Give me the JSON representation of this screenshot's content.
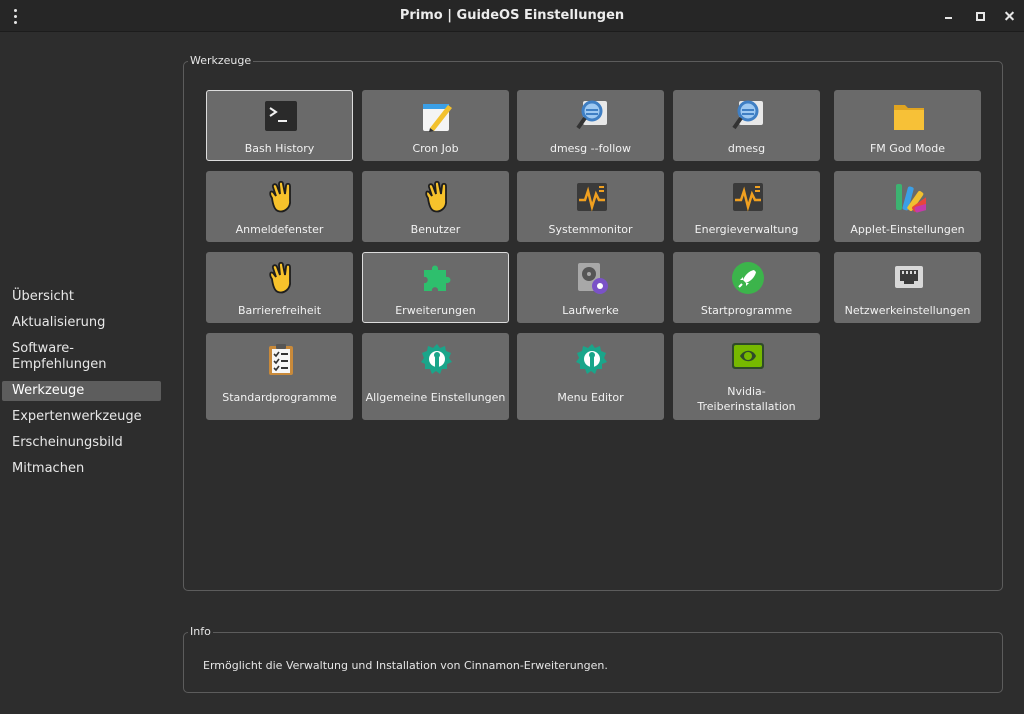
{
  "window": {
    "title": "Primo | GuideOS Einstellungen"
  },
  "sidebar": {
    "items": [
      {
        "label": "Übersicht"
      },
      {
        "label": "Aktualisierung"
      },
      {
        "label": "Software-\nEmpfehlungen"
      },
      {
        "label": "Werkzeuge"
      },
      {
        "label": "Expertenwerkzeuge"
      },
      {
        "label": "Erscheinungsbild"
      },
      {
        "label": "Mitmachen"
      }
    ],
    "selected": "Werkzeuge"
  },
  "tools": {
    "section_label": "Werkzeuge",
    "tiles": [
      {
        "label": "Bash History",
        "icon": "terminal-icon"
      },
      {
        "label": "Cron Job",
        "icon": "notepad-pencil-icon"
      },
      {
        "label": "dmesg --follow",
        "icon": "log-search-icon"
      },
      {
        "label": "dmesg",
        "icon": "log-search-icon"
      },
      {
        "label": "FM God Mode",
        "icon": "folder-icon"
      },
      {
        "label": "Anmeldefenster",
        "icon": "waving-hand-icon"
      },
      {
        "label": "Benutzer",
        "icon": "waving-hand-icon"
      },
      {
        "label": "Systemmonitor",
        "icon": "activity-monitor-icon"
      },
      {
        "label": "Energieverwaltung",
        "icon": "activity-monitor-icon"
      },
      {
        "label": "Applet-Einstellungen",
        "icon": "color-palette-icon"
      },
      {
        "label": "Barrierefreiheit",
        "icon": "waving-hand-icon"
      },
      {
        "label": "Erweiterungen",
        "icon": "puzzle-piece-icon"
      },
      {
        "label": "Laufwerke",
        "icon": "disk-settings-icon"
      },
      {
        "label": "Startprogramme",
        "icon": "rocket-icon"
      },
      {
        "label": "Netzwerkeinstellungen",
        "icon": "network-port-icon"
      },
      {
        "label": "Standardprogramme",
        "icon": "clipboard-checklist-icon"
      },
      {
        "label": "Allgemeine Einstellungen",
        "icon": "wrench-gear-icon"
      },
      {
        "label": "Menu Editor",
        "icon": "wrench-gear-icon"
      },
      {
        "label": "Nvidia-\nTreiberinstallation",
        "icon": "nvidia-icon"
      }
    ],
    "selected": "Erweiterungen"
  },
  "info": {
    "section_label": "Info",
    "text": "Ermöglicht die Verwaltung und Installation von Cinnamon-Erweiterungen."
  },
  "colors": {
    "window_bg": "#2d2d2d",
    "tile_bg": "#6a6a6a",
    "sidebar_selected_bg": "#5d5d5d"
  }
}
